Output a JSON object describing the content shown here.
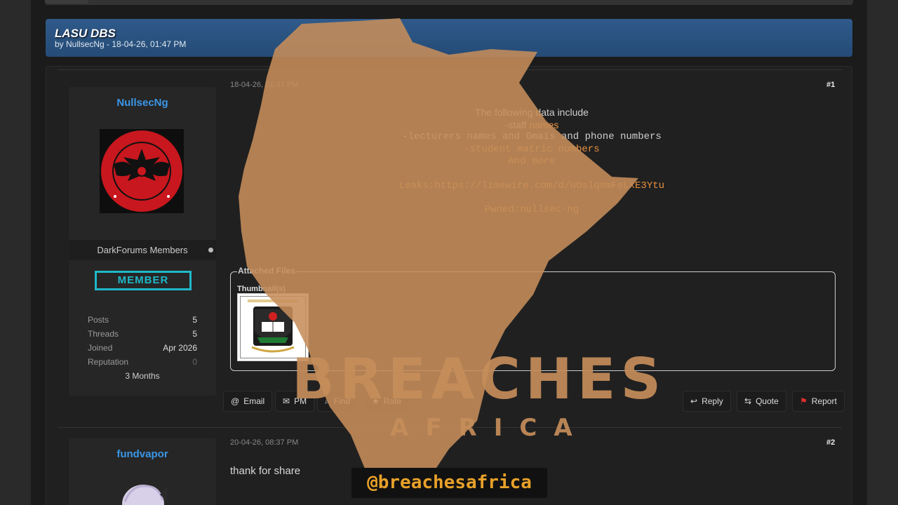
{
  "thread": {
    "title": "LASU DBS",
    "meta": "by NullsecNg - 18-04-26, 01:47 PM"
  },
  "posts": [
    {
      "date": "18-04-26, 01:47 PM",
      "number": "#1",
      "author": {
        "name": "NullsecNg",
        "avatar_icon": "nsn-emblem-avatar",
        "group": "DarkForums Members",
        "badge": "MEMBER",
        "stats": {
          "posts_label": "Posts",
          "posts": "5",
          "threads_label": "Threads",
          "threads": "5",
          "joined_label": "Joined",
          "joined": "Apr 2026",
          "reputation_label": "Reputation",
          "reputation": "0",
          "tenure": "3 Months"
        }
      },
      "body": {
        "line1": "The following data include",
        "line2_a": "-staff ",
        "line2_b": "names",
        "line3_a": "-lecturers names and Gmais",
        "line3_b": " and phone numbers",
        "line4": "-student matric numbers",
        "line5": "And more",
        "line6": "Leaks:https://limewire.com/d/uOslq#mFeLxE3Ytu",
        "line7": "Pwned:nullsec-ng"
      },
      "attachments": {
        "legend": "Attached Files",
        "thumbs_label": "Thumbnail(s)",
        "thumb_icon": "lasu-crest-thumbnail"
      },
      "actions": {
        "email": "Email",
        "pm": "PM",
        "find": "Find",
        "rate": "Rate",
        "reply": "Reply",
        "quote": "Quote",
        "report": "Report"
      }
    },
    {
      "date": "20-04-26, 08:37 PM",
      "number": "#2",
      "author": {
        "name": "fundvapor",
        "avatar_icon": "anime-avatar"
      },
      "body": {
        "text": "thank for share"
      }
    }
  ],
  "watermark": {
    "word1": "BREACHES",
    "word2": "AFRICA",
    "handle": "@breachesafrica",
    "color": "#c68d5a"
  },
  "colors": {
    "header_blue": "#2f5a8a",
    "username_blue": "#3a96e6",
    "member_teal": "#1fb8c8",
    "orange_text": "#e8913f",
    "report_red": "#e53030"
  }
}
